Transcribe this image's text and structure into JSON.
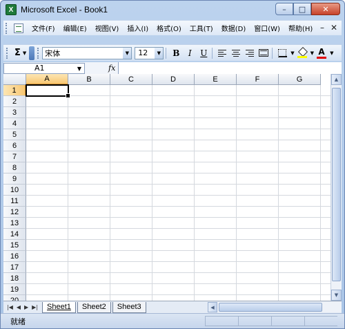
{
  "window": {
    "title": "Microsoft Excel - Book1",
    "app_icon_glyph": "X",
    "minimize_glyph": "–",
    "maximize_glyph": "□",
    "close_glyph": "✕"
  },
  "menu": {
    "items": [
      {
        "label": "文件(F)"
      },
      {
        "label": "编辑(E)"
      },
      {
        "label": "视图(V)"
      },
      {
        "label": "插入(I)"
      },
      {
        "label": "格式(O)"
      },
      {
        "label": "工具(T)"
      },
      {
        "label": "数据(D)"
      },
      {
        "label": "窗口(W)"
      },
      {
        "label": "帮助(H)"
      }
    ],
    "doc_min_glyph": "–",
    "doc_close_glyph": "✕"
  },
  "toolbar": {
    "autosum_glyph": "Σ",
    "font_name": "宋体",
    "font_size": "12",
    "bold": "B",
    "italic": "I",
    "underline": "U",
    "font_color_glyph": "A"
  },
  "formula_bar": {
    "name_box": "A1",
    "fx_label": "fx",
    "formula": ""
  },
  "grid": {
    "columns": [
      "A",
      "B",
      "C",
      "D",
      "E",
      "F",
      "G"
    ],
    "rows": [
      "1",
      "2",
      "3",
      "4",
      "5",
      "6",
      "7",
      "8",
      "9",
      "10",
      "11",
      "12",
      "13",
      "14",
      "15",
      "16",
      "17",
      "18",
      "19",
      "20"
    ],
    "active_column": "A",
    "active_row": "1"
  },
  "sheets": {
    "tabs": [
      {
        "label": "Sheet1",
        "active": true
      },
      {
        "label": "Sheet2",
        "active": false
      },
      {
        "label": "Sheet3",
        "active": false
      }
    ]
  },
  "status": {
    "text": "就绪"
  },
  "colors": {
    "title_gradient": "#bcd3ee",
    "active_header": "#f8c773",
    "close_button": "#c7422a"
  }
}
